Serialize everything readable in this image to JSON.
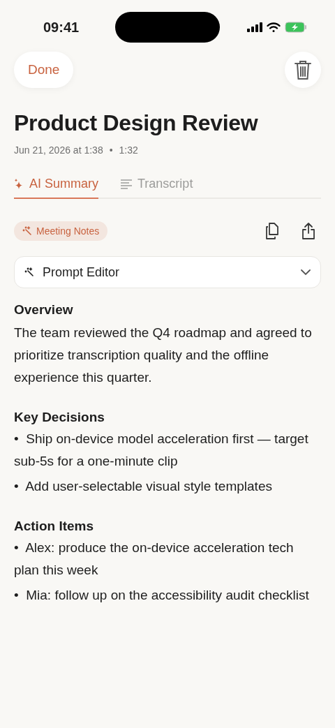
{
  "status_bar": {
    "time": "09:41"
  },
  "nav": {
    "done": "Done"
  },
  "title": "Product Design Review",
  "meta": {
    "date": "Jun 21, 2026 at 1:38",
    "separator": "•",
    "duration": "1:32"
  },
  "tabs": [
    {
      "label": "AI Summary",
      "kind": "sparkle",
      "selected": true
    },
    {
      "label": "Transcript",
      "kind": "lines",
      "selected": false
    }
  ],
  "tag": "Meeting Notes",
  "prompt_editor": {
    "label": "Prompt Editor"
  },
  "sections": [
    {
      "heading": "Overview",
      "kind": "paragraph",
      "text": "The team reviewed the Q4 roadmap and agreed to prioritize transcription quality and the offline experience this quarter."
    },
    {
      "heading": "Key Decisions",
      "kind": "bullets",
      "items": [
        "•  Ship on-device model acceleration first — target sub-5s for a one-minute clip",
        "•  Add user-selectable visual style templates"
      ]
    },
    {
      "heading": "Action Items",
      "kind": "bullets",
      "items": [
        "•  Alex: produce the on-device acceleration tech plan this week",
        "•  Mia: follow up on the accessibility audit checklist"
      ]
    }
  ]
}
